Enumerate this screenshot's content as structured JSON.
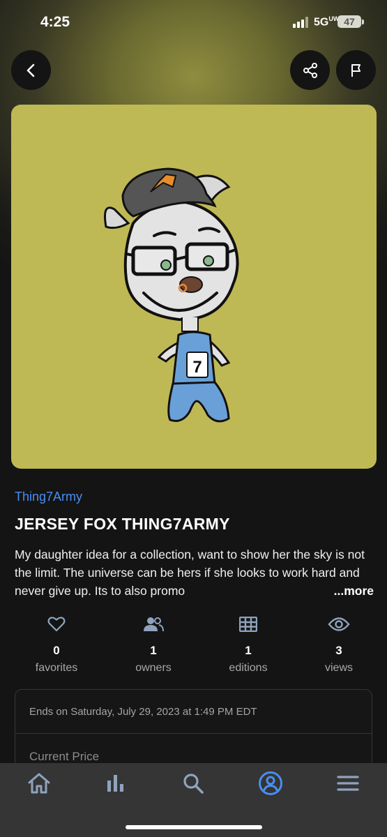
{
  "status_bar": {
    "time": "4:25",
    "network": "5G",
    "network_sup": "UW",
    "battery": "47"
  },
  "header": {
    "back_icon": "chevron-left-icon",
    "share_icon": "share-icon",
    "flag_icon": "flag-icon"
  },
  "artwork": {
    "background_color": "#bfb955",
    "jersey_number": "7"
  },
  "nft": {
    "collection": "Thing7Army",
    "title": "JERSEY FOX THING7ARMY",
    "description": "My daughter idea for a collection, want to show her the sky is not the limit. The universe can be hers if she looks to work hard and never give up. Its to also promo",
    "more_label": "...more"
  },
  "stats": [
    {
      "icon": "heart-icon",
      "value": "0",
      "label": "favorites"
    },
    {
      "icon": "people-icon",
      "value": "1",
      "label": "owners"
    },
    {
      "icon": "grid-icon",
      "value": "1",
      "label": "editions"
    },
    {
      "icon": "eye-icon",
      "value": "3",
      "label": "views"
    }
  ],
  "auction": {
    "ends_text": "Ends on Saturday, July 29, 2023 at 1:49 PM EDT",
    "price_label": "Current Price"
  },
  "tab_bar": {
    "items": [
      {
        "icon": "home-icon",
        "active": false
      },
      {
        "icon": "bar-chart-icon",
        "active": false
      },
      {
        "icon": "search-icon",
        "active": false
      },
      {
        "icon": "profile-icon",
        "active": true
      },
      {
        "icon": "menu-icon",
        "active": false
      }
    ],
    "accent_color": "#4a8ef0",
    "inactive_color": "#8fa3bd"
  }
}
